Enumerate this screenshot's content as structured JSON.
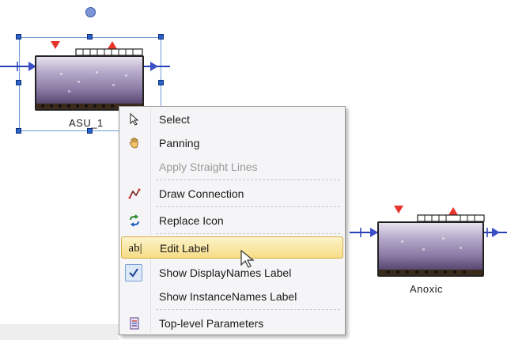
{
  "colors": {
    "flow": "#2a3fb6",
    "marker": "#e8352b",
    "selection": "#5b8fd8",
    "highlight": "#f6dd87"
  },
  "canvas": {
    "units": [
      {
        "label": "ASU_1",
        "selected": true
      },
      {
        "label": "Anoxic",
        "selected": false
      }
    ]
  },
  "context_menu": {
    "items": [
      {
        "label": "Select",
        "icon": "cursor-arrow-icon",
        "enabled": true
      },
      {
        "label": "Panning",
        "icon": "hand-icon",
        "enabled": true
      },
      {
        "label": "Apply Straight Lines",
        "icon": "",
        "enabled": false
      },
      {
        "label": "Draw Connection",
        "icon": "connection-line-icon",
        "enabled": true
      },
      {
        "label": "Replace Icon",
        "icon": "replace-arrows-icon",
        "enabled": true
      },
      {
        "label": "Edit Label",
        "icon": "ab-text-icon",
        "glyph": "ab|",
        "enabled": true,
        "hovered": true
      },
      {
        "label": "Show DisplayNames Label",
        "icon": "check-icon",
        "enabled": true,
        "checked": true
      },
      {
        "label": "Show InstanceNames Label",
        "icon": "",
        "enabled": true,
        "checked": false
      },
      {
        "label": "Top-level Parameters",
        "icon": "parameters-document-icon",
        "enabled": true
      }
    ]
  }
}
